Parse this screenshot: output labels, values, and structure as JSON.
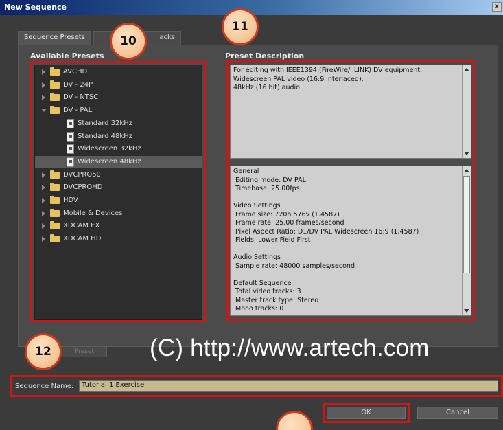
{
  "window": {
    "title": "New Sequence",
    "close_label": "x"
  },
  "tabs": [
    {
      "label": "Sequence Presets"
    },
    {
      "label": "acks"
    }
  ],
  "presets": {
    "heading": "Available Presets",
    "items": [
      {
        "label": "AVCHD",
        "type": "folder",
        "expanded": false
      },
      {
        "label": "DV - 24P",
        "type": "folder",
        "expanded": false
      },
      {
        "label": "DV - NTSC",
        "type": "folder",
        "expanded": false
      },
      {
        "label": "DV - PAL",
        "type": "folder",
        "expanded": true
      },
      {
        "label": "Standard 32kHz",
        "type": "preset"
      },
      {
        "label": "Standard 48kHz",
        "type": "preset"
      },
      {
        "label": "Widescreen 32kHz",
        "type": "preset"
      },
      {
        "label": "Widescreen 48kHz",
        "type": "preset",
        "selected": true
      },
      {
        "label": "DVCPRO50",
        "type": "folder",
        "expanded": false
      },
      {
        "label": "DVCPROHD",
        "type": "folder",
        "expanded": false
      },
      {
        "label": "HDV",
        "type": "folder",
        "expanded": false
      },
      {
        "label": "Mobile & Devices",
        "type": "folder",
        "expanded": false
      },
      {
        "label": "XDCAM EX",
        "type": "folder",
        "expanded": false
      },
      {
        "label": "XDCAM HD",
        "type": "folder",
        "expanded": false
      }
    ]
  },
  "description": {
    "heading": "Preset Description",
    "summary": [
      "For editing with IEEE1394 (FireWire/i.LINK) DV equipment.",
      "Widescreen PAL video (16:9 interlaced).",
      "48kHz (16 bit) audio."
    ],
    "details": [
      "General",
      " Editing mode: DV PAL",
      " Timebase: 25.00fps",
      "",
      "Video Settings",
      " Frame size: 720h 576v (1.4587)",
      " Frame rate: 25.00 frames/second",
      " Pixel Aspect Ratio: D1/DV PAL Widescreen 16:9 (1.4587)",
      " Fields: Lower Field First",
      "",
      "Audio Settings",
      " Sample rate: 48000 samples/second",
      "",
      "Default Sequence",
      " Total video tracks: 3",
      " Master track type: Stereo",
      " Mono tracks: 0"
    ]
  },
  "delete_preset": {
    "label": "Preset"
  },
  "watermark": "(C) http://www.artech.com",
  "sequence_name": {
    "label": "Sequence Name:",
    "value": "Tutorial 1 Exercise"
  },
  "buttons": {
    "ok": "OK",
    "cancel": "Cancel"
  },
  "callouts": {
    "b10": "10",
    "b11": "11",
    "b12": "12"
  },
  "colors": {
    "highlight": "#d01515",
    "dialog_bg": "#3b3b3b",
    "title_blue": "#0a246a"
  }
}
